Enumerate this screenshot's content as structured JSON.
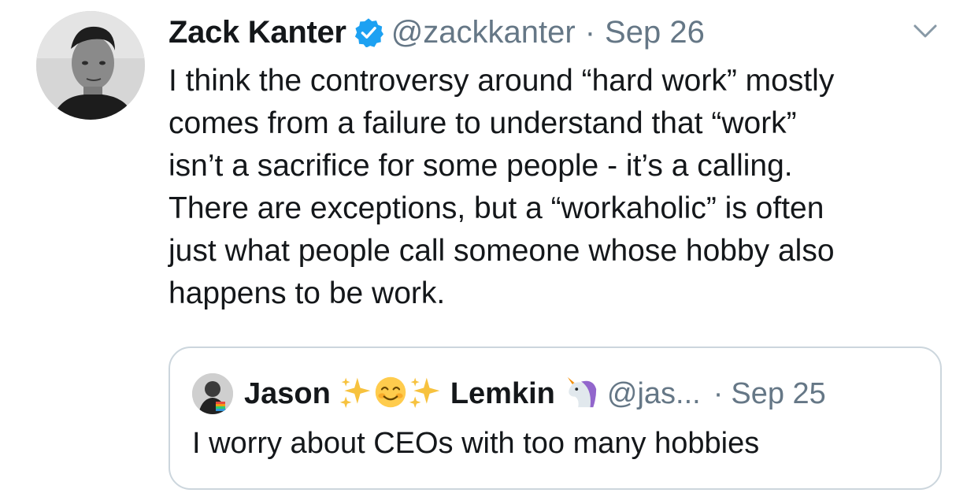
{
  "tweet": {
    "author_name": "Zack Kanter",
    "author_handle": "@zackkanter",
    "separator": "·",
    "date": "Sep 26",
    "text": "I think the controversy around “hard work” mostly\ncomes from a failure to understand that “work”\nisn’t a sacrifice for some people - it’s a calling.\nThere are exceptions, but a “workaholic” is often\njust what people call someone whose hobby also\nhappens to be work.",
    "icons": {
      "verified": "verified-badge-icon",
      "menu": "chevron-down-icon"
    }
  },
  "quoted_tweet": {
    "name_first": "Jason",
    "name_last": "Lemkin",
    "name_emojis": [
      "sparkles",
      "smiling-face-with-smiling-eyes",
      "sparkles"
    ],
    "name_suffix_emoji": "unicorn",
    "handle": "@jas...",
    "separator": "·",
    "date": "Sep 25",
    "text": "I worry about CEOs with too many hobbies"
  },
  "colors": {
    "primary_text": "#14171a",
    "secondary_text": "#657786",
    "verified_blue": "#1da1f2",
    "border": "#ccd6dd"
  }
}
